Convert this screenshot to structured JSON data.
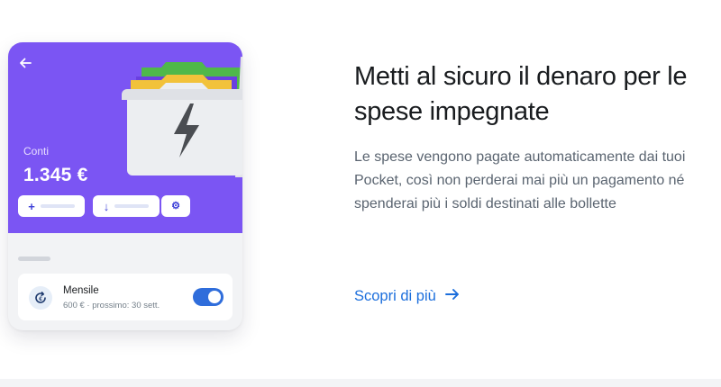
{
  "card": {
    "accounts_label": "Conti",
    "balance": "1.345 €",
    "actions": {
      "add_glyph": "+",
      "move_glyph": "↓",
      "settings_glyph": "⚙"
    },
    "pocket": {
      "title": "Mensile",
      "subtitle": "600 € · prossimo: 30 sett.",
      "enabled": true
    }
  },
  "content": {
    "headline": "Metti al sicuro il denaro per le spese impegnate",
    "description": "Le spese vengono pagate automaticamente dai tuoi Pocket, così non perderai mai più un pagamento né spenderai più i soldi destinati alle bollette",
    "cta_label": "Scopri di più",
    "cta_arrow": "→"
  },
  "colors": {
    "card_accent": "#7b55f3",
    "link": "#1b6edc",
    "toggle_on": "#2f6ddb"
  },
  "icons": [
    "back-arrow-icon",
    "plus-icon",
    "down-arrow-icon",
    "gear-icon",
    "lightning-folder-icon",
    "recurring-payment-icon",
    "arrow-right-icon"
  ]
}
